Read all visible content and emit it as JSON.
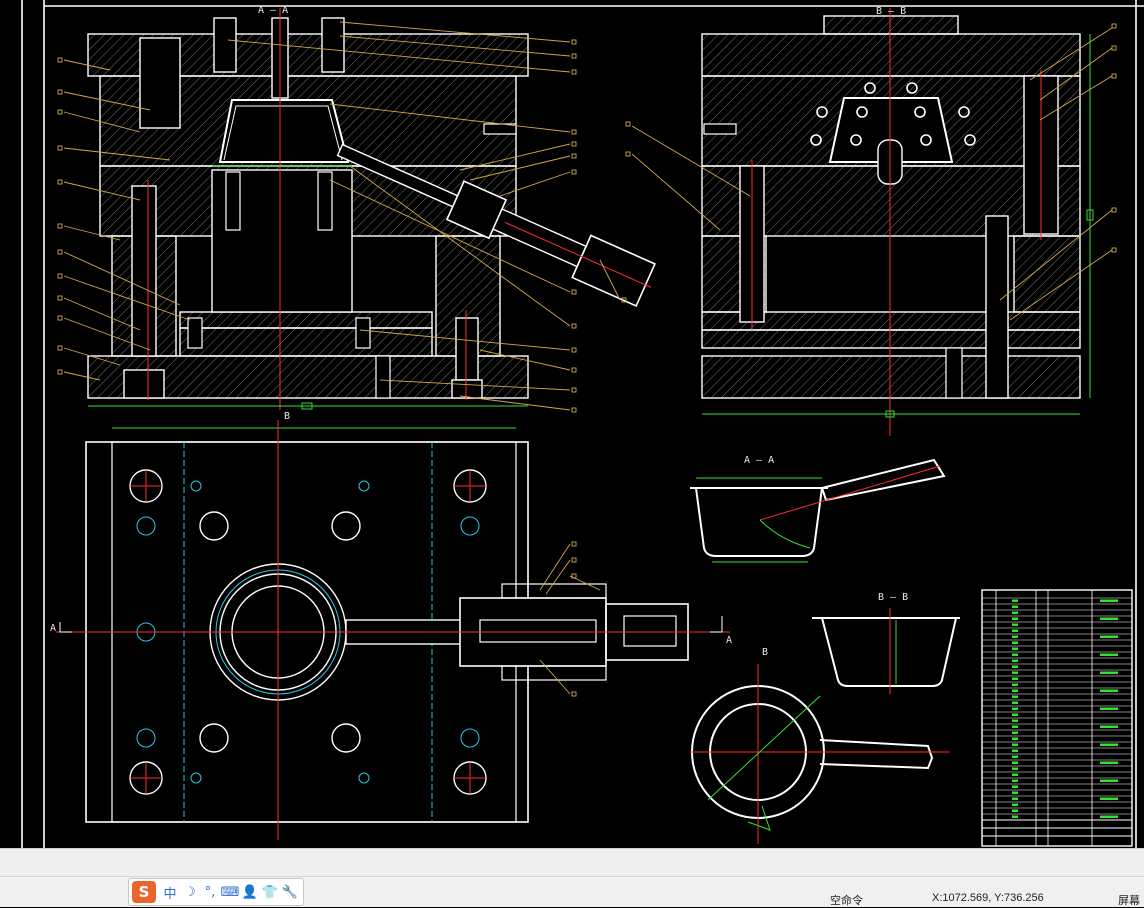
{
  "drawing": {
    "section_labels": {
      "top_left_section": "A — A",
      "top_right_section": "B — B",
      "plan_dim": "B",
      "plan_A_left": "A",
      "plan_A_right": "A",
      "part_section_a": "A — A",
      "part_section_b": "B — B",
      "part_plan_b": "B"
    },
    "colors": {
      "background": "#000000",
      "outline": "#ffffff",
      "hatch": "#8c8c8c",
      "centerline": "#ff2b2b",
      "leader": "#d2a84a",
      "dimension": "#33e033",
      "hidden": "#25c8e6"
    }
  },
  "ime_toolbar": {
    "logo": "S",
    "mode_label": "中",
    "icons": [
      "moon-icon",
      "punctuation-icon",
      "keyboard-icon",
      "user-icon",
      "skin-icon",
      "wrench-icon"
    ]
  },
  "status": {
    "command_label": "空命令",
    "coordinates": "X:1072.569, Y:736.256",
    "screen_label": "屏幕"
  }
}
